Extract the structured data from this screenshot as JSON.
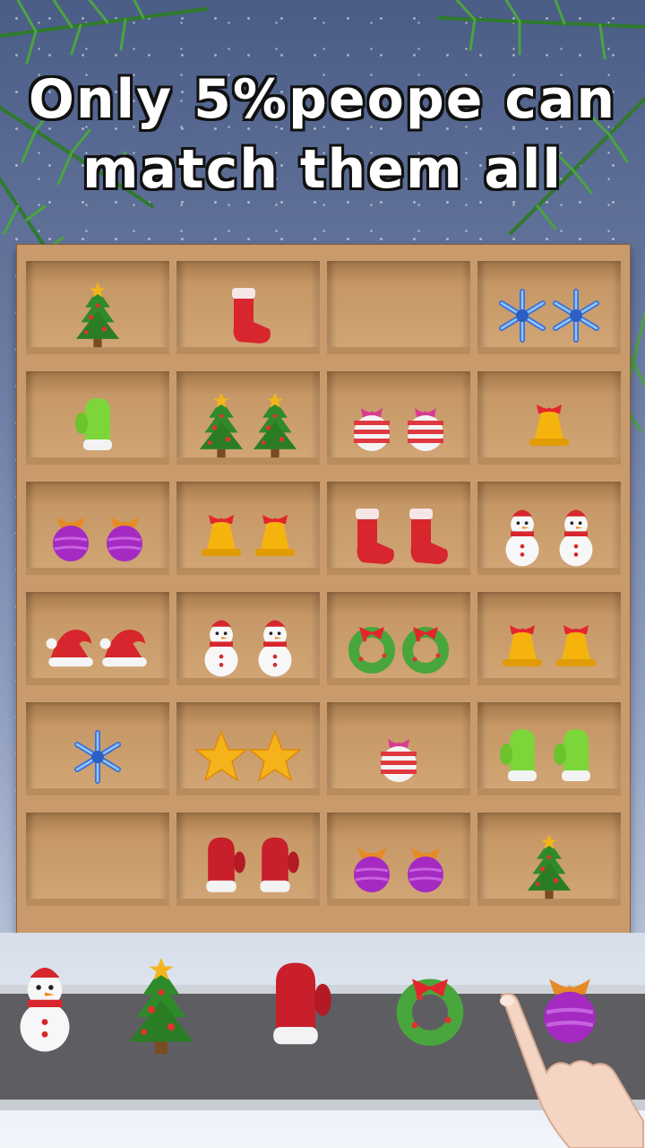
{
  "headline": {
    "line1": "Only 5%peope can",
    "line2": "match them all"
  },
  "colors": {
    "wood": "#c99b6c",
    "belt": "#5e5e62",
    "title_text": "#ffffff"
  },
  "shelf": {
    "rows": [
      [
        [
          "tree-icon"
        ],
        [
          "stocking-icon"
        ],
        [],
        [
          "snowflake-icon",
          "snowflake-icon"
        ]
      ],
      [
        [
          "mitten-green-icon"
        ],
        [
          "tree-icon",
          "tree-icon"
        ],
        [
          "ornament-striped-icon",
          "ornament-striped-icon"
        ],
        [
          "bell-icon"
        ]
      ],
      [
        [
          "ornament-purple-icon",
          "ornament-purple-icon"
        ],
        [
          "bell-icon",
          "bell-icon"
        ],
        [
          "stocking-icon",
          "stocking-icon"
        ],
        [
          "snowman-icon",
          "snowman-icon"
        ]
      ],
      [
        [
          "santa-hat-icon",
          "santa-hat-icon"
        ],
        [
          "snowman-icon",
          "snowman-icon"
        ],
        [
          "wreath-icon",
          "wreath-icon"
        ],
        [
          "bell-icon",
          "bell-icon"
        ]
      ],
      [
        [
          "snowflake-icon"
        ],
        [
          "star-icon",
          "star-icon"
        ],
        [
          "ornament-striped-icon"
        ],
        [
          "mitten-green-icon",
          "mitten-green-icon"
        ]
      ],
      [
        [],
        [
          "mitten-red-icon",
          "mitten-red-icon"
        ],
        [
          "ornament-purple-icon",
          "ornament-purple-icon"
        ],
        [
          "tree-icon"
        ]
      ]
    ]
  },
  "tray": [
    "snowman-icon",
    "tree-icon",
    "mitten-red-icon",
    "wreath-icon",
    "ornament-purple-icon"
  ]
}
